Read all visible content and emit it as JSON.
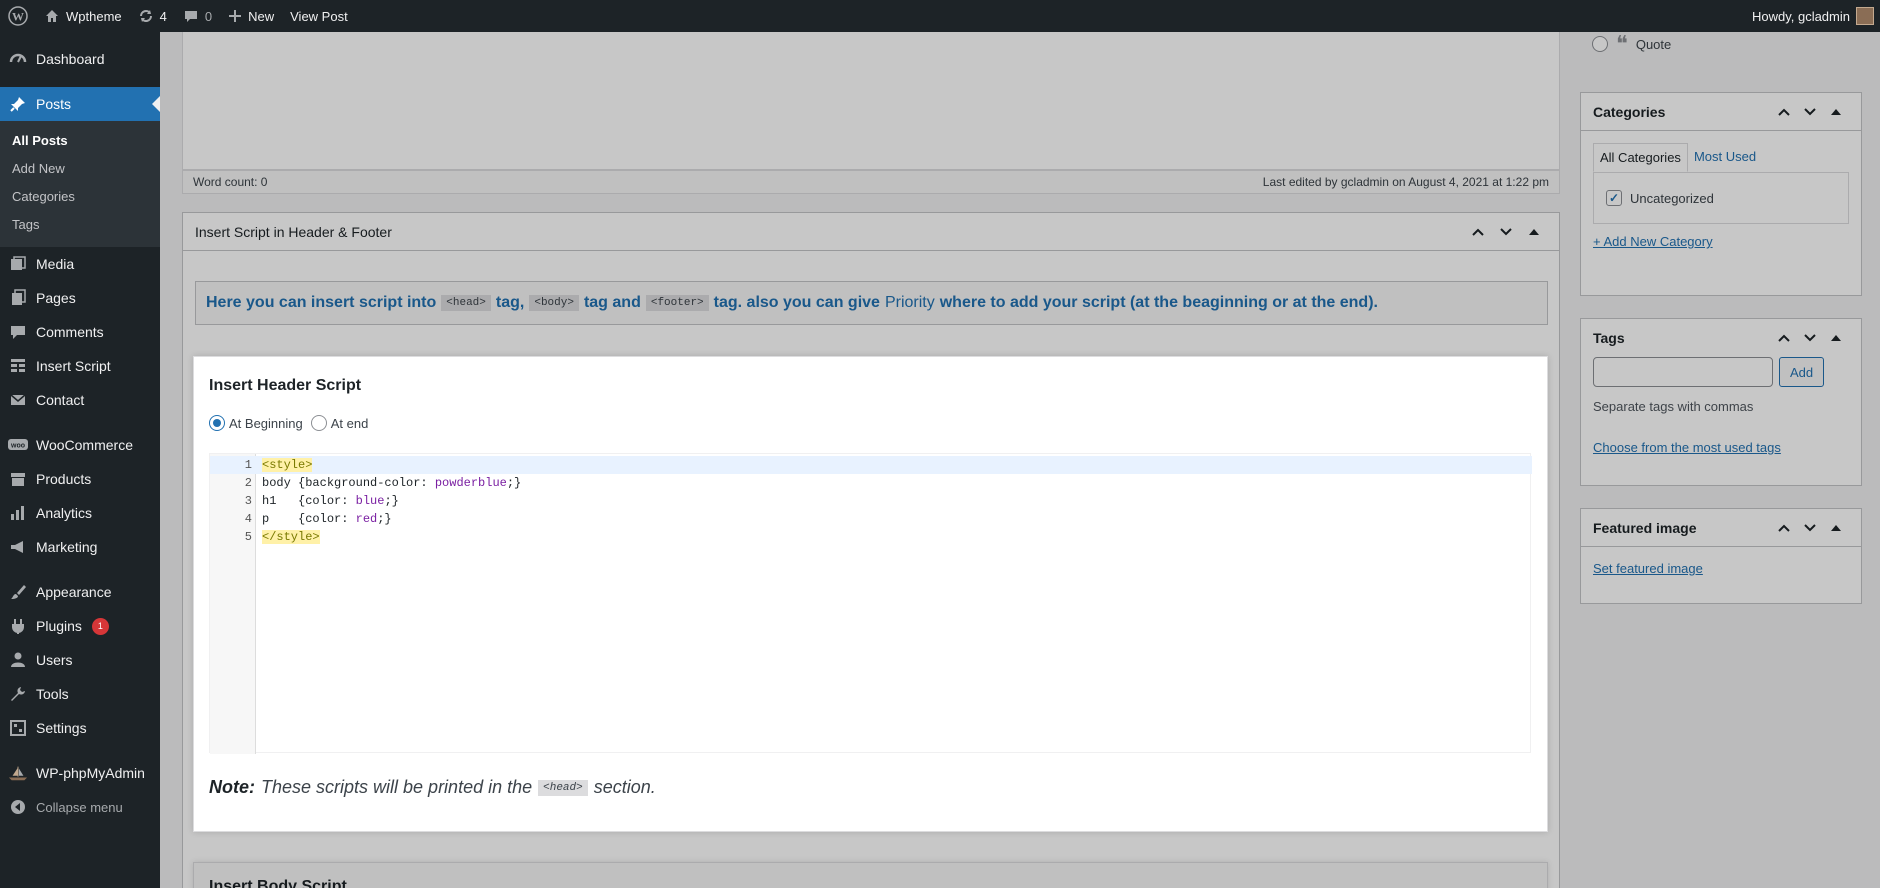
{
  "adminbar": {
    "site_name": "Wptheme",
    "updates_count": "4",
    "comments_count": "0",
    "new_label": "New",
    "view_post_label": "View Post",
    "howdy": "Howdy, gcladmin"
  },
  "sidebar": {
    "items": [
      {
        "label": "Dashboard",
        "icon": "dashboard-icon"
      },
      {
        "label": "Posts",
        "icon": "pin-icon"
      },
      {
        "label": "Media",
        "icon": "media-icon"
      },
      {
        "label": "Pages",
        "icon": "pages-icon"
      },
      {
        "label": "Comments",
        "icon": "comments-icon"
      },
      {
        "label": "Insert Script",
        "icon": "table-icon"
      },
      {
        "label": "Contact",
        "icon": "mail-icon"
      },
      {
        "label": "WooCommerce",
        "icon": "woo-icon"
      },
      {
        "label": "Products",
        "icon": "archive-icon"
      },
      {
        "label": "Analytics",
        "icon": "bar-chart-icon"
      },
      {
        "label": "Marketing",
        "icon": "megaphone-icon"
      },
      {
        "label": "Appearance",
        "icon": "brush-icon"
      },
      {
        "label": "Plugins",
        "icon": "plug-icon",
        "badge": "1"
      },
      {
        "label": "Users",
        "icon": "user-icon"
      },
      {
        "label": "Tools",
        "icon": "wrench-icon"
      },
      {
        "label": "Settings",
        "icon": "settings-icon"
      },
      {
        "label": "WP-phpMyAdmin",
        "icon": "ship-icon"
      }
    ],
    "posts_submenu": [
      "All Posts",
      "Add New",
      "Categories",
      "Tags"
    ],
    "collapse_label": "Collapse menu"
  },
  "editor": {
    "word_count": "Word count: 0",
    "last_edited": "Last edited by gcladmin on August 4, 2021 at 1:22 pm"
  },
  "script_box": {
    "title": "Insert Script in Header & Footer",
    "info": {
      "part1": "Here you can insert script into",
      "code_head": "<head>",
      "part2": "tag,",
      "code_body": "<body>",
      "part3": "tag and",
      "code_footer": "<footer>",
      "part4": "tag. also you can give",
      "priority": "Priority",
      "part5": "where to add your script (at the beaginning or at the end)."
    },
    "header_card": {
      "title": "Insert Header Script",
      "radio_beginning": "At Beginning",
      "radio_end": "At end",
      "selected": "At Beginning",
      "code_lines": [
        {
          "num": "1",
          "text": "<style>"
        },
        {
          "num": "2",
          "sel": "body",
          "open": " {background-color: ",
          "val": "powderblue",
          "close": ";}"
        },
        {
          "num": "3",
          "sel": "h1",
          "open": "   {color: ",
          "val": "blue",
          "close": ";}"
        },
        {
          "num": "4",
          "sel": "p",
          "open": "    {color: ",
          "val": "red",
          "close": ";}"
        },
        {
          "num": "5",
          "text": "</style>"
        }
      ],
      "note_label": "Note:",
      "note_text": "These scripts will be printed in the",
      "note_code": "<head>",
      "note_end": "section."
    },
    "body_card_title": "Insert Body Script"
  },
  "right_sidebar": {
    "format_quote": "Quote",
    "categories": {
      "title": "Categories",
      "tab_all": "All Categories",
      "tab_most": "Most Used",
      "item": "Uncategorized",
      "add_link": "+ Add New Category"
    },
    "tags": {
      "title": "Tags",
      "add_btn": "Add",
      "hint": "Separate tags with commas",
      "choose_link": "Choose from the most used tags"
    },
    "featured": {
      "title": "Featured image",
      "set_link": "Set featured image"
    }
  },
  "colors": {
    "adminbar_bg": "#1d2327",
    "accent": "#2271b1",
    "badge": "#d63638"
  }
}
